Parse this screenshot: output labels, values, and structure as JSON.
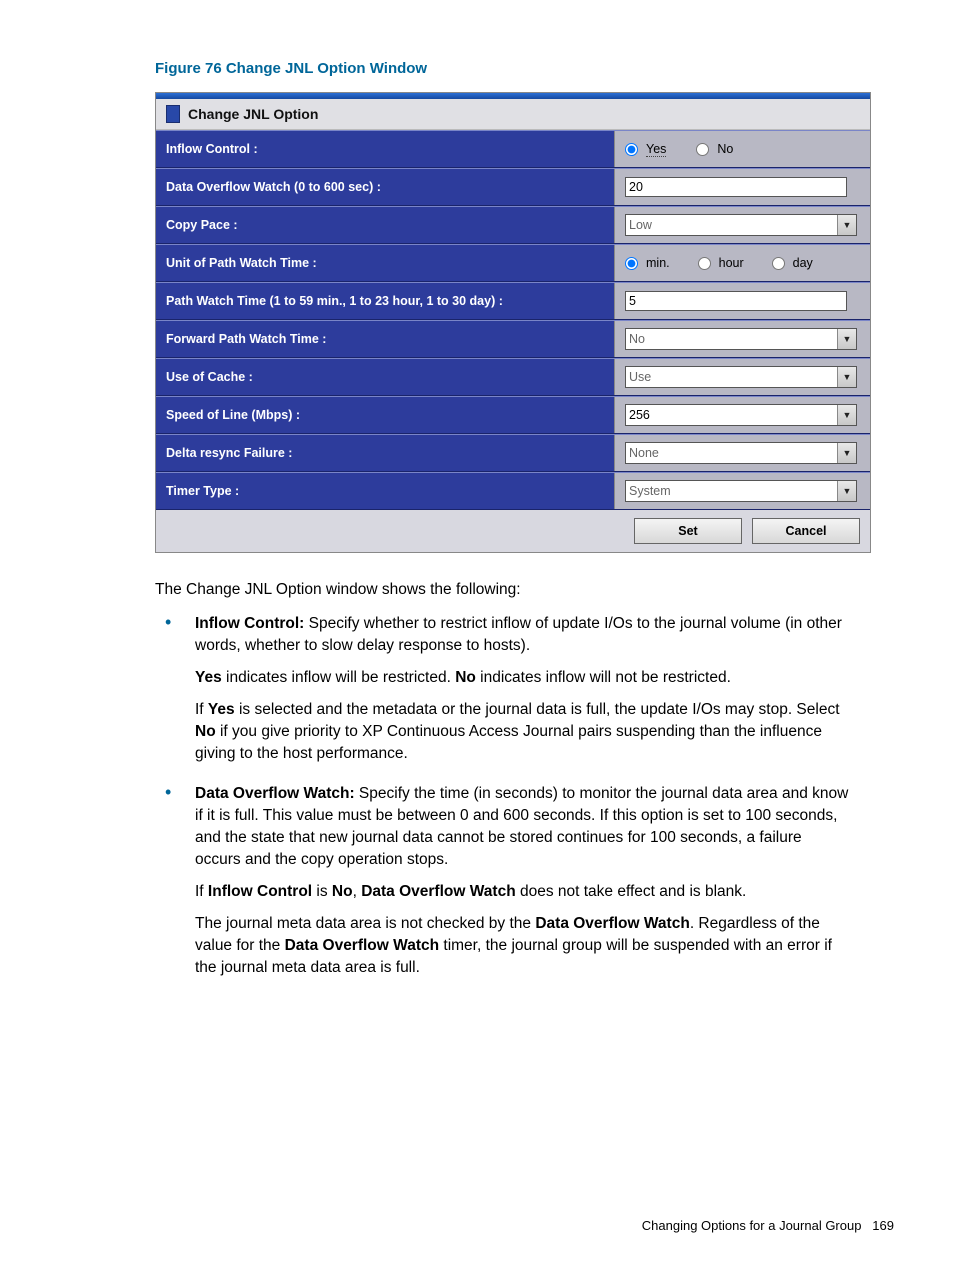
{
  "caption": "Figure 76 Change JNL Option Window",
  "window": {
    "title": "Change JNL Option",
    "rows": {
      "inflow": {
        "label": "Inflow Control :",
        "yes": "Yes",
        "no": "No"
      },
      "overflow": {
        "label": "Data Overflow Watch (0 to 600 sec) :",
        "value": "20"
      },
      "copypace": {
        "label": "Copy Pace :",
        "value": "Low"
      },
      "unit": {
        "label": "Unit of Path Watch Time :",
        "min": "min.",
        "hour": "hour",
        "day": "day"
      },
      "pathwatch": {
        "label": "Path Watch Time (1 to 59 min., 1 to 23 hour, 1 to 30 day) :",
        "value": "5"
      },
      "forward": {
        "label": "Forward Path Watch Time :",
        "value": "No"
      },
      "cache": {
        "label": "Use of Cache :",
        "value": "Use"
      },
      "speed": {
        "label": "Speed of Line (Mbps) :",
        "value": "256"
      },
      "delta": {
        "label": "Delta resync Failure :",
        "value": "None"
      },
      "timer": {
        "label": "Timer Type :",
        "value": "System"
      }
    },
    "buttons": {
      "set": "Set",
      "cancel": "Cancel"
    }
  },
  "text": {
    "intro": "The Change JNL Option window shows the following:",
    "b1_title": "Inflow Control:",
    "b1_p1": " Specify whether to restrict inflow of update I/Os to the journal volume (in other words, whether to slow delay response to hosts).",
    "b1_p2a": "Yes",
    "b1_p2b": " indicates inflow will be restricted. ",
    "b1_p2c": "No",
    "b1_p2d": " indicates inflow will not be restricted.",
    "b1_p3a": "If ",
    "b1_p3b": "Yes",
    "b1_p3c": " is selected and the metadata or the journal data is full, the update I/Os may stop. Select ",
    "b1_p3d": "No",
    "b1_p3e": " if you give priority to XP Continuous Access Journal pairs suspending than the influence giving to the host performance.",
    "b2_title": "Data Overflow Watch:",
    "b2_p1": " Specify the time (in seconds) to monitor the journal data area and know if it is full. This value must be between 0 and 600 seconds. If this option is set to 100 seconds, and the state that new journal data cannot be stored continues for 100 seconds, a failure occurs and the copy operation stops.",
    "b2_p2a": "If ",
    "b2_p2b": "Inflow Control",
    "b2_p2c": " is ",
    "b2_p2d": "No",
    "b2_p2e": ", ",
    "b2_p2f": "Data Overflow Watch",
    "b2_p2g": " does not take effect and is blank.",
    "b2_p3a": "The journal meta data area is not checked by the ",
    "b2_p3b": "Data Overflow Watch",
    "b2_p3c": ". Regardless of the value for the ",
    "b2_p3d": "Data Overflow Watch",
    "b2_p3e": " timer, the journal group will be suspended with an error if the journal meta data area is full."
  },
  "footer": {
    "section": "Changing Options for a Journal Group",
    "page": "169"
  }
}
